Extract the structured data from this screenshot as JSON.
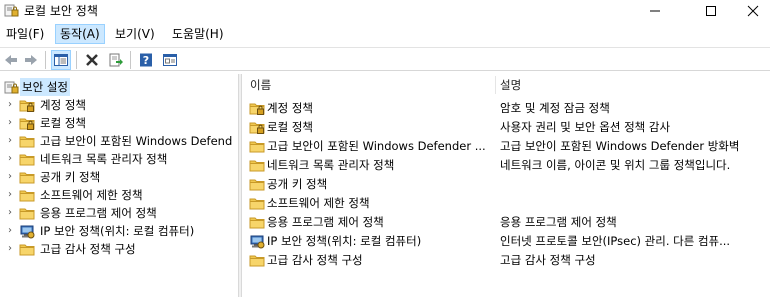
{
  "window": {
    "title": "로컬 보안 정책"
  },
  "menu": {
    "file": "파일(F)",
    "action": "동작(A)",
    "view": "보기(V)",
    "help": "도움말(H)"
  },
  "tree": {
    "root": "보안 설정",
    "items": [
      {
        "label": "계정 정책",
        "icon": "policy-folder-icon"
      },
      {
        "label": "로컬 정책",
        "icon": "policy-folder-icon"
      },
      {
        "label": "고급 보안이 포함된 Windows Defend",
        "icon": "folder-icon"
      },
      {
        "label": "네트워크 목록 관리자 정책",
        "icon": "folder-icon"
      },
      {
        "label": "공개 키 정책",
        "icon": "folder-icon"
      },
      {
        "label": "소프트웨어 제한 정책",
        "icon": "folder-icon"
      },
      {
        "label": "응용 프로그램 제어 정책",
        "icon": "folder-icon"
      },
      {
        "label": "IP 보안 정책(위치: 로컬 컴퓨터)",
        "icon": "ipsec-icon"
      },
      {
        "label": "고급 감사 정책 구성",
        "icon": "folder-icon"
      }
    ]
  },
  "list": {
    "columns": {
      "name": "이름",
      "description": "설명"
    },
    "rows": [
      {
        "name": "계정 정책",
        "description": "암호 및 계정 잠금 정책",
        "icon": "policy-folder-icon"
      },
      {
        "name": "로컬 정책",
        "description": "사용자 권리 및 보안 옵션 정책 감사",
        "icon": "policy-folder-icon"
      },
      {
        "name": "고급 보안이 포함된 Windows Defender ...",
        "description": "고급 보안이 포함된 Windows Defender 방화벽",
        "icon": "folder-icon"
      },
      {
        "name": "네트워크 목록 관리자 정책",
        "description": "네트워크 이름, 아이콘 및 위치 그룹 정책입니다.",
        "icon": "folder-icon"
      },
      {
        "name": "공개 키 정책",
        "description": "",
        "icon": "folder-icon"
      },
      {
        "name": "소프트웨어 제한 정책",
        "description": "",
        "icon": "folder-icon"
      },
      {
        "name": "응용 프로그램 제어 정책",
        "description": "응용 프로그램 제어 정책",
        "icon": "folder-icon"
      },
      {
        "name": "IP 보안 정책(위치: 로컬 컴퓨터)",
        "description": "인터넷 프로토콜 보안(IPsec) 관리. 다른 컴퓨...",
        "icon": "ipsec-icon"
      },
      {
        "name": "고급 감사 정책 구성",
        "description": "고급 감사 정책 구성",
        "icon": "folder-icon"
      }
    ]
  },
  "colors": {
    "selection": "#cce8ff",
    "folder": "#e8c15a",
    "accent": "#0a64c8"
  }
}
